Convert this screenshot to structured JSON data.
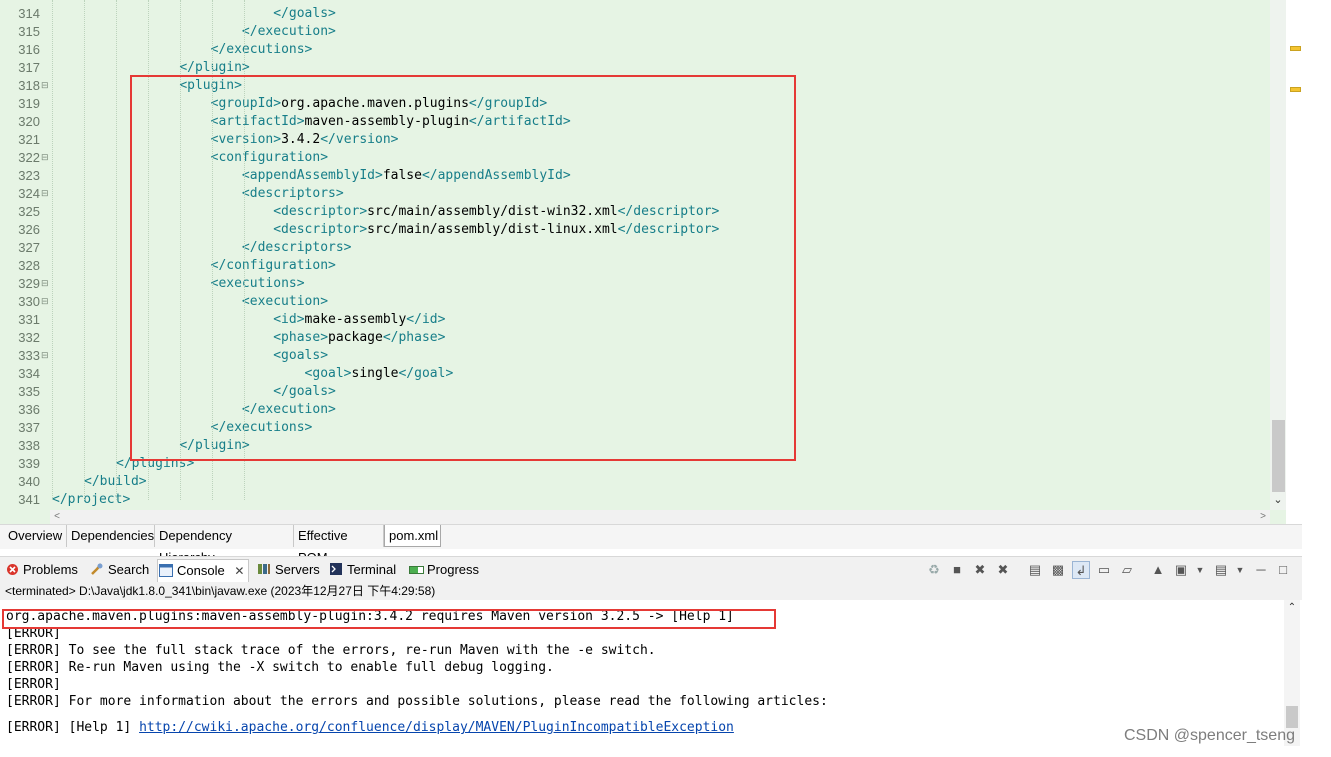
{
  "editor": {
    "lines": [
      {
        "num": "314",
        "text": "                </goals>"
      },
      {
        "num": "315",
        "text": "            </execution>"
      },
      {
        "num": "316",
        "text": "        </executions>"
      },
      {
        "num": "317",
        "text": "    </plugin>"
      },
      {
        "num": "318",
        "text": "    <plugin>"
      },
      {
        "num": "319",
        "text": "        <groupId>org.apache.maven.plugins</groupId>"
      },
      {
        "num": "320",
        "text": "        <artifactId>maven-assembly-plugin</artifactId>"
      },
      {
        "num": "321",
        "text": "        <version>3.4.2</version>"
      },
      {
        "num": "322",
        "text": "        <configuration>"
      },
      {
        "num": "323",
        "text": "            <appendAssemblyId>false</appendAssemblyId>"
      },
      {
        "num": "324",
        "text": "            <descriptors>"
      },
      {
        "num": "325",
        "text": "                <descriptor>src/main/assembly/dist-win32.xml</descriptor>"
      },
      {
        "num": "326",
        "text": "                <descriptor>src/main/assembly/dist-linux.xml</descriptor>"
      },
      {
        "num": "327",
        "text": "            </descriptors>"
      },
      {
        "num": "328",
        "text": "        </configuration>"
      },
      {
        "num": "329",
        "text": "        <executions>"
      },
      {
        "num": "330",
        "text": "            <execution>"
      },
      {
        "num": "331",
        "text": "                <id>make-assembly</id>"
      },
      {
        "num": "332",
        "text": "                <phase>package</phase>"
      },
      {
        "num": "333",
        "text": "                <goals>"
      },
      {
        "num": "334",
        "text": "                    <goal>single</goal>"
      },
      {
        "num": "335",
        "text": "                </goals>"
      },
      {
        "num": "336",
        "text": "            </execution>"
      },
      {
        "num": "337",
        "text": "        </executions>"
      },
      {
        "num": "338",
        "text": "    </plugin>"
      },
      {
        "num": "339",
        "text": "</plugins>"
      },
      {
        "num": "340",
        "text": "</build>"
      },
      {
        "num": "341",
        "text": "</project>"
      }
    ]
  },
  "page_tabs": [
    "Overview",
    "Dependencies",
    "Dependency Hierarchy",
    "Effective POM",
    "pom.xml"
  ],
  "views": {
    "problems": "Problems",
    "search": "Search",
    "console": "Console",
    "servers": "Servers",
    "terminal": "Terminal",
    "progress": "Progress"
  },
  "console": {
    "terminated": "<terminated> D:\\Java\\jdk1.8.0_341\\bin\\javaw.exe (2023年12月27日 下午4:29:58)",
    "lines": [
      "org.apache.maven.plugins:maven-assembly-plugin:3.4.2 requires Maven version 3.2.5 -> [Help 1]",
      "[ERROR] ",
      "[ERROR] To see the full stack trace of the errors, re-run Maven with the -e switch.",
      "[ERROR] Re-run Maven using the -X switch to enable full debug logging.",
      "[ERROR] ",
      "[ERROR] For more information about the errors and possible solutions, please read the following articles:"
    ],
    "help_prefix": "[ERROR] [Help 1] ",
    "help_link": "http://cwiki.apache.org/confluence/display/MAVEN/PluginIncompatibleException"
  },
  "watermark": "CSDN @spencer_tseng"
}
